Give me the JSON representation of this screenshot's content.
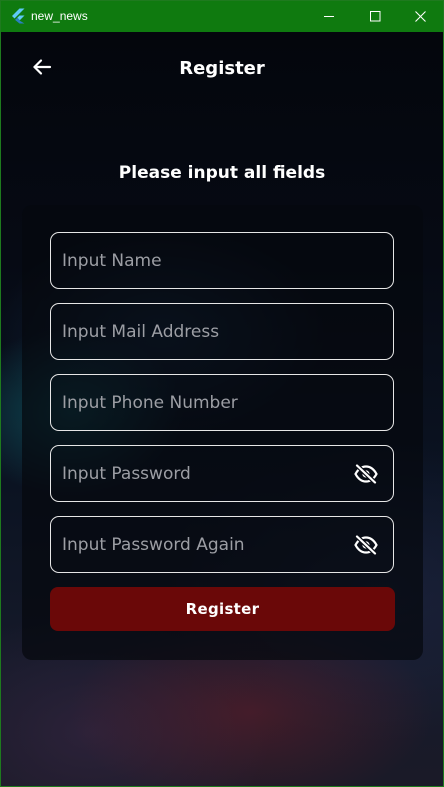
{
  "window": {
    "title": "new_news",
    "title_bar_color": "#0f7a0f"
  },
  "appbar": {
    "title": "Register",
    "back_icon": "arrow-back-icon"
  },
  "form": {
    "heading": "Please input all fields",
    "fields": [
      {
        "placeholder": "Input Name",
        "value": "",
        "type": "text"
      },
      {
        "placeholder": "Input Mail Address",
        "value": "",
        "type": "email"
      },
      {
        "placeholder": "Input Phone Number",
        "value": "",
        "type": "tel"
      },
      {
        "placeholder": "Input Password",
        "value": "",
        "type": "password",
        "trailing_icon": "visibility-off-icon"
      },
      {
        "placeholder": "Input Password Again",
        "value": "",
        "type": "password",
        "trailing_icon": "visibility-off-icon"
      }
    ],
    "submit_label": "Register",
    "submit_color": "#6a0808"
  }
}
